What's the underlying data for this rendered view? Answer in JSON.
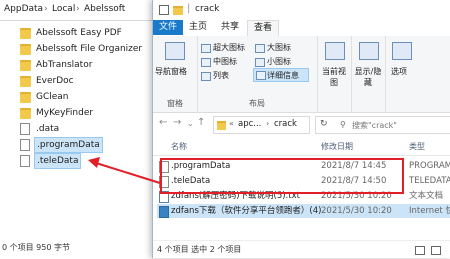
{
  "background_window": {
    "breadcrumb": [
      "AppData",
      "Local",
      "Abelssoft"
    ],
    "items": [
      {
        "label": "Abelssoft Easy PDF",
        "kind": "folder"
      },
      {
        "label": "Abelssoft File Organizer",
        "kind": "folder"
      },
      {
        "label": "AbTranslator",
        "kind": "folder"
      },
      {
        "label": "EverDoc",
        "kind": "folder"
      },
      {
        "label": "GClean",
        "kind": "folder"
      },
      {
        "label": "MyKeyFinder",
        "kind": "folder"
      },
      {
        "label": ".data",
        "kind": "file"
      },
      {
        "label": ".programData",
        "kind": "file"
      },
      {
        "label": ".teleData",
        "kind": "file"
      }
    ],
    "status": "0 个项目  950 字节"
  },
  "window": {
    "title": "crack",
    "tabs": [
      "文件",
      "主页",
      "共享",
      "查看"
    ],
    "ribbon": {
      "nav_pane": "导航窗格",
      "pane_caption": "窗格",
      "layout_items": [
        "超大图标",
        "大图标",
        "中图标",
        "小图标",
        "列表",
        "详细信息"
      ],
      "layout_caption": "布局",
      "current_view": "当前视图",
      "show_hide": "显示/隐藏",
      "options": "选项"
    },
    "address": [
      "apc...",
      "crack"
    ],
    "search_placeholder": "搜索\"crack\"",
    "columns": [
      "名称",
      "修改日期",
      "类型"
    ],
    "files": [
      {
        "name": ".programData",
        "date": "2021/8/7 14:45",
        "type": "PROGRAMDA"
      },
      {
        "name": ".teleData",
        "date": "2021/8/7 14:50",
        "type": "TELEDATA 文"
      },
      {
        "name": "zdfans(解压密码)下载说明(5).txt",
        "date": "2021/5/30 10:20",
        "type": "文本文档"
      },
      {
        "name": "zdfans下载（软件分享平台领跑者）(4)",
        "date": "2021/5/30 10:20",
        "type": "Internet 快捷"
      }
    ],
    "status": "4 个项目   选中 2 个项目"
  },
  "colors": {
    "accent": "#1979ca",
    "annotation": "#e21f26",
    "selection": "#cce4f7"
  }
}
